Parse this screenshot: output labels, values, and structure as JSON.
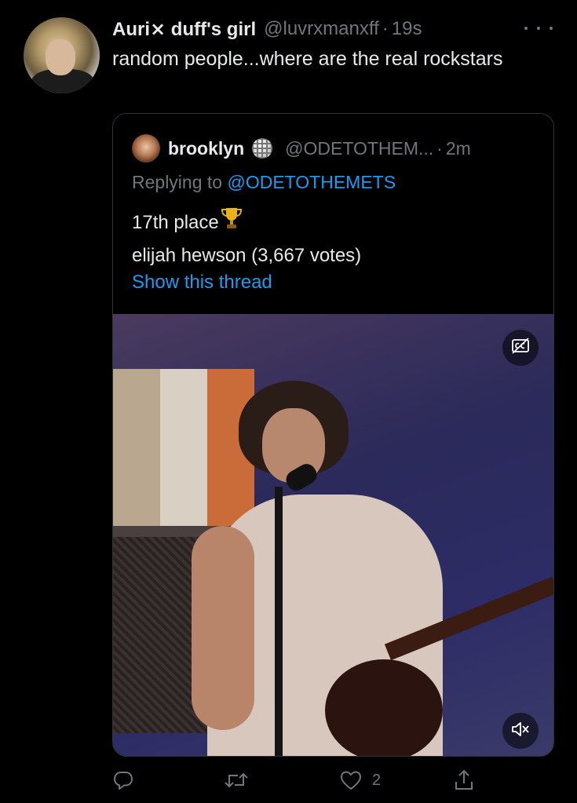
{
  "tweet": {
    "display_name": "Auri⨯ duff's girl",
    "handle": "@luvrxmanxff",
    "separator": "·",
    "time": "19s",
    "text": "random people...where are the real rockstars"
  },
  "quoted_tweet": {
    "display_name": "brooklyn",
    "badge_icon": "disco-ball-icon",
    "handle": "@ODETOTHEM...",
    "separator": "·",
    "time": "2m",
    "replying_prefix": "Replying to",
    "replying_to": "@ODETOTHEMETS",
    "line1": "17th place",
    "line1_icon": "trophy-icon",
    "line2": "elijah hewson (3,667 votes)",
    "show_thread": "Show this thread",
    "media": {
      "cc_icon": "closed-captions-icon",
      "mute_icon": "muted-speaker-icon"
    }
  },
  "actions": {
    "reply_icon": "reply-icon",
    "retweet_icon": "retweet-icon",
    "like_icon": "heart-icon",
    "like_count": "2",
    "share_icon": "share-icon"
  },
  "colors": {
    "background": "#000000",
    "text": "#e7e9ea",
    "secondary": "#71767b",
    "accent": "#1d9bf0",
    "border": "#2f3336"
  }
}
